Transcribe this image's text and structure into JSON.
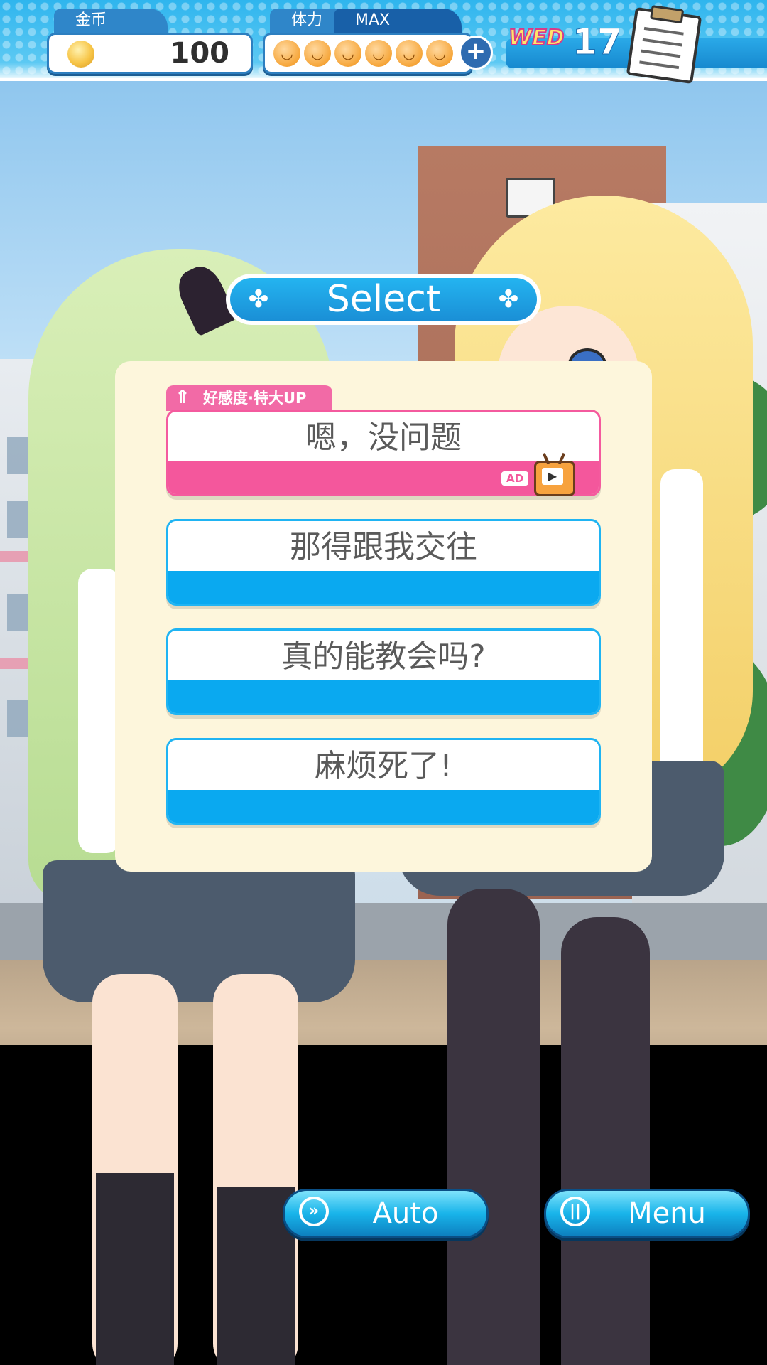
{
  "hud": {
    "coins": {
      "label": "金币",
      "value": "100"
    },
    "stamina": {
      "label": "体力",
      "status": "MAX",
      "pips": 6,
      "add_button": "+"
    },
    "date": {
      "weekday": "WED",
      "day": "17"
    }
  },
  "dialog": {
    "title": "Select",
    "choices": [
      {
        "label": "嗯，没问题",
        "style": "pink",
        "bonus_tag": "好感度·特大UP",
        "ad_badge": "AD"
      },
      {
        "label": "那得跟我交往",
        "style": "blue"
      },
      {
        "label": "真的能教会吗?",
        "style": "blue"
      },
      {
        "label": "麻烦死了!",
        "style": "blue"
      }
    ]
  },
  "controls": {
    "auto_label": "Auto",
    "menu_label": "Menu"
  },
  "colors": {
    "accent_blue": "#0aa9f0",
    "accent_pink": "#f4579c",
    "panel": "#fdf6dc"
  }
}
